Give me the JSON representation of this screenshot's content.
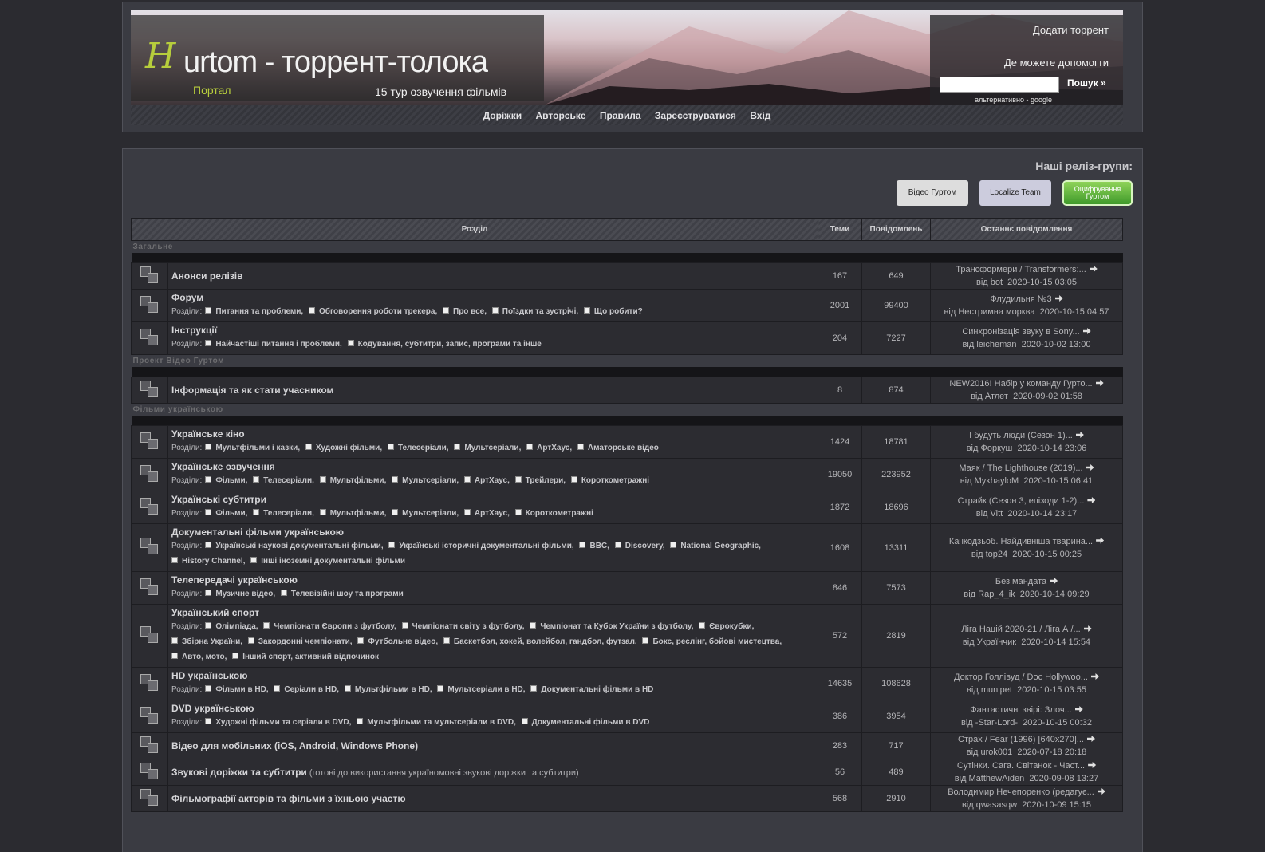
{
  "header": {
    "logo_h": "H",
    "logo_rest": "urtom - торрент-толока",
    "portal": "Портал",
    "tour": "15 тур озвучення фільмів",
    "add_torrent": "Додати торрент",
    "help": "Де можете допомогти",
    "search_button": "Пошук »",
    "alt_google": "альтернативно - google",
    "search_value": ""
  },
  "nav": [
    "Доріжки",
    "Авторське",
    "Правила",
    "Зареєструватися",
    "Вхід"
  ],
  "release_groups": {
    "title": "Наші реліз-групи:",
    "logos": [
      "Відео Гуртом",
      "Localize Team",
      "Оцифрування Гуртом"
    ]
  },
  "table": {
    "headers": [
      "Розділ",
      "Теми",
      "Повідомлень",
      "Останнє повідомлення"
    ],
    "sub_label": "Розділи:",
    "by_label": "від",
    "categories": [
      {
        "name": "Загальне",
        "forums": [
          {
            "title": "Анонси релізів",
            "subs": [],
            "topics": "167",
            "posts": "649",
            "last_title": "Трансформери / Transformers:...",
            "last_user": "bot",
            "last_date": "2020-10-15 03:05"
          },
          {
            "title": "Форум",
            "subs": [
              "Питання та проблеми",
              "Обговорення роботи трекера",
              "Про все",
              "Поїздки та зустрічі",
              "Що робити?"
            ],
            "topics": "2001",
            "posts": "99400",
            "last_title": "Флудильня №3",
            "last_user": "Нестримна морква",
            "last_date": "2020-10-15 04:57"
          },
          {
            "title": "Інструкції",
            "subs": [
              "Найчастіші питання і проблеми",
              "Кодування, субтитри, запис, програми та інше"
            ],
            "topics": "204",
            "posts": "7227",
            "last_title": "Синхронізація звуку в Sony...",
            "last_user": "leicheman",
            "last_date": "2020-10-02 13:00"
          }
        ]
      },
      {
        "name": "Проект Відео Гуртом",
        "forums": [
          {
            "title": "Інформація та як стати учасником",
            "subs": [],
            "topics": "8",
            "posts": "874",
            "last_title": "NEW2016! Набір у команду Гурто...",
            "last_user": "Атлет",
            "last_date": "2020-09-02 01:58"
          }
        ]
      },
      {
        "name": "Фільми українською",
        "forums": [
          {
            "title": "Українське кіно",
            "subs": [
              "Мультфільми і казки",
              "Художні фільми",
              "Телесеріали",
              "Мультсеріали",
              "АртХаус",
              "Аматорське відео"
            ],
            "topics": "1424",
            "posts": "18781",
            "last_title": "І будуть люди (Сезон 1)...",
            "last_user": "Форкуш",
            "last_date": "2020-10-14 23:06"
          },
          {
            "title": "Українське озвучення",
            "subs": [
              "Фільми",
              "Телесеріали",
              "Мультфільми",
              "Мультсеріали",
              "АртХаус",
              "Трейлери",
              "Короткометражні"
            ],
            "topics": "19050",
            "posts": "223952",
            "last_title": "Маяк / The Lighthouse (2019)...",
            "last_user": "MykhayloM",
            "last_date": "2020-10-15 06:41"
          },
          {
            "title": "Українські субтитри",
            "subs": [
              "Фільми",
              "Телесеріали",
              "Мультфільми",
              "Мультсеріали",
              "АртХаус",
              "Короткометражні"
            ],
            "topics": "1872",
            "posts": "18696",
            "last_title": "Страйк (Сезон 3, епізоди 1-2)...",
            "last_user": "Vitt",
            "last_date": "2020-10-14 23:17"
          },
          {
            "title": "Документальні фільми українською",
            "subs": [
              "Українські наукові документальні фільми",
              "Українські історичні документальні фільми",
              "BBC",
              "Discovery",
              "National Geographic",
              "History Channel",
              "Інші іноземні документальні фільми"
            ],
            "topics": "1608",
            "posts": "13311",
            "last_title": "Качкодзьоб. Найдивніша тварина...",
            "last_user": "top24",
            "last_date": "2020-10-15 00:25"
          },
          {
            "title": "Телепередачі українською",
            "subs": [
              "Музичне відео",
              "Телевізійні шоу та програми"
            ],
            "topics": "846",
            "posts": "7573",
            "last_title": "Без мандата",
            "last_user": "Rap_4_ik",
            "last_date": "2020-10-14 09:29"
          },
          {
            "title": "Український спорт",
            "subs": [
              "Олімпіада",
              "Чемпіонати Європи з футболу",
              "Чемпіонати світу з футболу",
              "Чемпіонат та Кубок України з футболу",
              "Єврокубки",
              "Збірна України",
              "Закордонні чемпіонати",
              "Футбольне відео",
              "Баскетбол, хокей, волейбол, гандбол, футзал",
              "Бокс, реслінг, бойові мистецтва",
              "Авто, мото",
              "Інший спорт, активний відпочинок"
            ],
            "topics": "572",
            "posts": "2819",
            "last_title": "Ліга Націй 2020-21 / Ліга А /...",
            "last_user": "Українчик",
            "last_date": "2020-10-14 15:54"
          },
          {
            "title": "HD українською",
            "subs": [
              "Фільми в HD",
              "Серіали в HD",
              "Мультфільми в HD",
              "Мультсеріали в HD",
              "Документальні фільми в HD"
            ],
            "topics": "14635",
            "posts": "108628",
            "last_title": "Доктор Голлівуд / Doc Hollywoo...",
            "last_user": "munipet",
            "last_date": "2020-10-15 03:55"
          },
          {
            "title": "DVD українською",
            "subs": [
              "Художні фільми та серіали в DVD",
              "Мультфільми та мультсеріали в DVD",
              "Документальні фільми в DVD"
            ],
            "topics": "386",
            "posts": "3954",
            "last_title": "Фантастичні звірі: Злоч...",
            "last_user": "-Star-Lord-",
            "last_date": "2020-10-15 00:32"
          },
          {
            "title": "Відео для мобільних (iOS, Android, Windows Phone)",
            "subs": [],
            "topics": "283",
            "posts": "717",
            "last_title": "Страх / Fear (1996) [640x270]...",
            "last_user": "urok001",
            "last_date": "2020-07-18 20:18"
          },
          {
            "title": "Звукові доріжки та субтитри",
            "desc": "(готові до використання україномовні звукові доріжки та субтитри)",
            "subs": [],
            "topics": "56",
            "posts": "489",
            "last_title": "Сутінки. Сага. Світанок - Част...",
            "last_user": "MatthewAiden",
            "last_date": "2020-09-08 13:27"
          },
          {
            "title": "Фільмографії акторів та фільми з їхньою участю",
            "subs": [],
            "topics": "568",
            "posts": "2910",
            "last_title": "Володимир Нечепоренко (редагує...",
            "last_user": "qwasasqw",
            "last_date": "2020-10-09 15:15"
          }
        ]
      }
    ]
  }
}
